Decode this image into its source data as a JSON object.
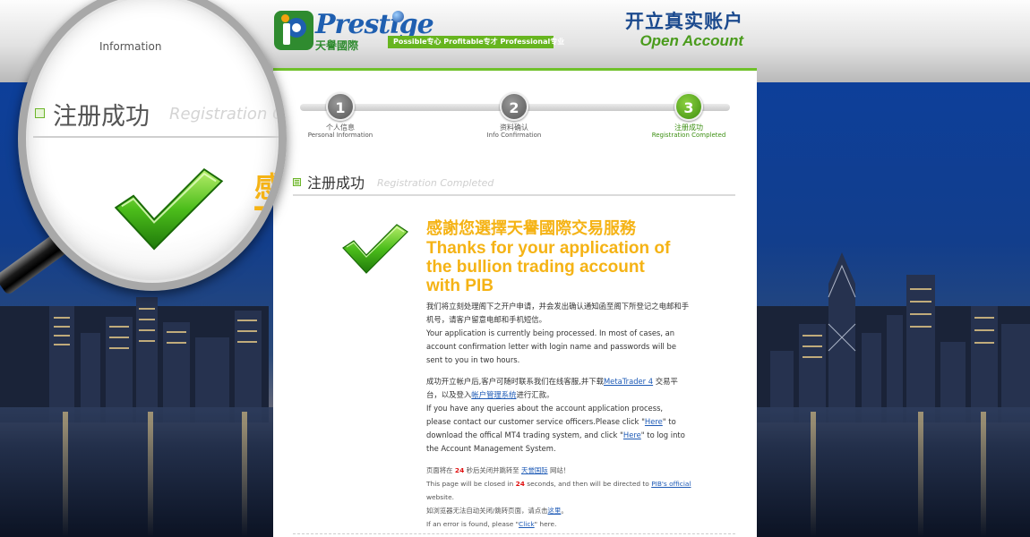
{
  "header": {
    "logo_word": "Prestige",
    "logo_cn": "天譽國際",
    "tagline": "Possible专心  Profitable专才  Professional专业",
    "title_cn": "开立真实账户",
    "title_en": "Open Account"
  },
  "steps": [
    {
      "num": "1",
      "label": "个人信息",
      "sub": "Personal Information",
      "state": "done"
    },
    {
      "num": "2",
      "label": "资料确认",
      "sub": "Info Confirmation",
      "state": "done"
    },
    {
      "num": "3",
      "label": "注册成功",
      "sub": "Registration Completed",
      "state": "active"
    }
  ],
  "section": {
    "title_cn": "注册成功",
    "title_en": "Registration Completed"
  },
  "thanks": {
    "cn": "感謝您選擇天譽國際交易服務",
    "en_line1": "Thanks for your application of",
    "en_line2": "the bullion trading account",
    "en_line3": "with PIB"
  },
  "body": {
    "p1_cn_line1": "我们将立刻处理阁下之开户申请，并会发出确认通知函至阁下所登记之电邮和手",
    "p1_cn_line2": "机号，请客户留意电邮和手机短信。",
    "p1_en_line1": "Your application is currently being processed. In most of cases, an",
    "p1_en_line2": "account confirmation letter with login name and passwords will be",
    "p1_en_line3": "sent to you in two hours.",
    "p2_cn_a": "成功开立帐户后,客户可随时联系我们在线客服,并下载",
    "p2_cn_link1": "MetaTrader 4",
    "p2_cn_b": " 交易平",
    "p2_cn_c": "台，以及登入",
    "p2_cn_link2": "帐户管理系统",
    "p2_cn_d": "进行汇款。",
    "p2_en_line1": "If you have any queries about the account application process,",
    "p2_en_line2a": "please contact our customer service officers.Please click \"",
    "p2_en_here1": "Here",
    "p2_en_line2b": "\" to",
    "p2_en_line3a": "download the offical MT4 trading system, and click \"",
    "p2_en_here2": "Here",
    "p2_en_line3b": "\" to log into",
    "p2_en_line4": "the Account Management System."
  },
  "notice": {
    "cn_a": "页面将在 ",
    "seconds": "24",
    "cn_b": " 秒后关闭并跳转至 ",
    "cn_link": "天誉国际",
    "cn_c": " 网站！",
    "en_a": "This page will be closed in ",
    "en_b": " seconds, and then will be directed to ",
    "en_link": "PIB's official",
    "en_c": "website.",
    "fallback_cn_a": "如浏览器无法自动关闭/跳转页面，请点击",
    "fallback_cn_link": "这里",
    "fallback_cn_b": "。",
    "fallback_en_a": "If an error is found, please \"",
    "fallback_en_link": "Click",
    "fallback_en_b": "\" here."
  },
  "magnifier": {
    "top_text": "Information",
    "title_cn": "注册成功",
    "title_en": "Registration C",
    "yellow_line1": "感",
    "yellow_line2": "T"
  },
  "colors": {
    "accent_green": "#6fc12a",
    "heading_yellow": "#f5b315",
    "link_blue": "#1d5ab6",
    "countdown_red": "#e01010"
  },
  "icons": {
    "success": "green-checkmark-icon",
    "section": "list-bullet-icon"
  }
}
